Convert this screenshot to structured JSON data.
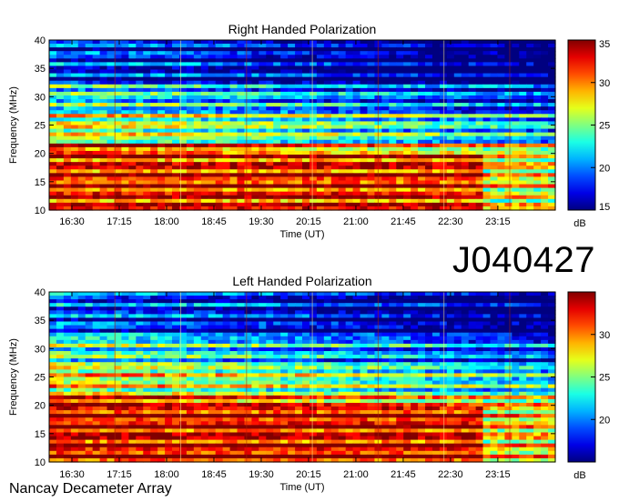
{
  "observation_id": "J040427",
  "instrument": "Nancay Decameter Array",
  "chart_data": [
    {
      "type": "heatmap",
      "title": "Right Handed Polarization",
      "xlabel": "Time (UT)",
      "ylabel": "Frequency (MHz)",
      "x_ticks": [
        "16:30",
        "17:15",
        "18:00",
        "18:45",
        "19:30",
        "20:15",
        "21:00",
        "21:45",
        "22:30",
        "23:15"
      ],
      "y_ticks": [
        10,
        15,
        20,
        25,
        30,
        35,
        40
      ],
      "ylim": [
        10,
        40
      ],
      "colorbar": {
        "label": "dB",
        "range": [
          15,
          35
        ],
        "ticks": [
          15,
          20,
          25,
          30,
          35
        ],
        "colormap": "jet"
      },
      "grid": false
    },
    {
      "type": "heatmap",
      "title": "Left Handed Polarization",
      "xlabel": "Time (UT)",
      "ylabel": "Frequency (MHz)",
      "x_ticks": [
        "16:30",
        "17:15",
        "18:00",
        "18:45",
        "19:30",
        "20:15",
        "21:00",
        "21:45",
        "22:30",
        "23:15"
      ],
      "y_ticks": [
        10,
        15,
        20,
        25,
        30,
        35,
        40
      ],
      "ylim": [
        10,
        40
      ],
      "colorbar": {
        "label": "dB",
        "range": [
          15,
          35
        ],
        "ticks": [
          20,
          25,
          30
        ],
        "colormap": "jet"
      },
      "grid": false
    }
  ]
}
